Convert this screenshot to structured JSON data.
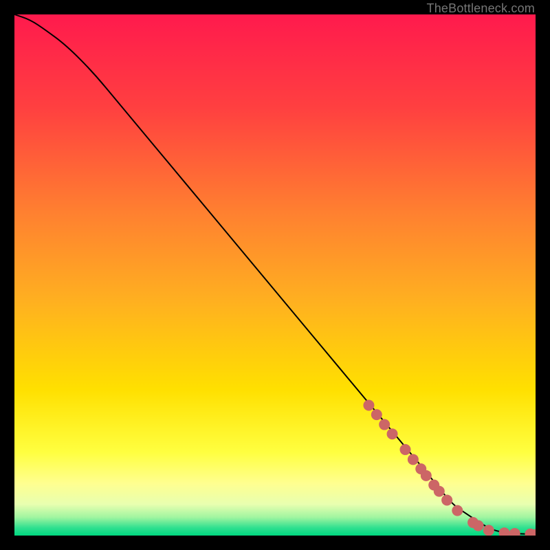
{
  "attribution": "TheBottleneck.com",
  "chart_data": {
    "type": "line",
    "title": "",
    "xlabel": "",
    "ylabel": "",
    "xlim": [
      0,
      100
    ],
    "ylim": [
      0,
      100
    ],
    "grid": false,
    "legend": false,
    "series": [
      {
        "name": "curve",
        "x": [
          0,
          3,
          6,
          10,
          15,
          20,
          25,
          30,
          35,
          40,
          45,
          50,
          55,
          60,
          65,
          70,
          75,
          80,
          84,
          87,
          90,
          92,
          94,
          96,
          98,
          100
        ],
        "y": [
          100,
          99,
          97,
          94,
          89,
          83,
          77,
          71,
          65,
          59,
          53,
          47,
          41,
          35,
          29,
          23,
          17,
          11,
          6,
          4,
          2,
          1,
          0.6,
          0.4,
          0.3,
          0.2
        ]
      }
    ],
    "markers": [
      {
        "x": 68.0,
        "y": 25.0
      },
      {
        "x": 69.5,
        "y": 23.2
      },
      {
        "x": 71.0,
        "y": 21.3
      },
      {
        "x": 72.5,
        "y": 19.5
      },
      {
        "x": 75.0,
        "y": 16.5
      },
      {
        "x": 76.5,
        "y": 14.6
      },
      {
        "x": 78.0,
        "y": 12.8
      },
      {
        "x": 79.0,
        "y": 11.5
      },
      {
        "x": 80.5,
        "y": 9.7
      },
      {
        "x": 81.5,
        "y": 8.5
      },
      {
        "x": 83.0,
        "y": 6.8
      },
      {
        "x": 85.0,
        "y": 4.8
      },
      {
        "x": 88.0,
        "y": 2.5
      },
      {
        "x": 89.0,
        "y": 1.9
      },
      {
        "x": 91.0,
        "y": 1.0
      },
      {
        "x": 94.0,
        "y": 0.5
      },
      {
        "x": 96.0,
        "y": 0.4
      },
      {
        "x": 99.0,
        "y": 0.3
      },
      {
        "x": 100.0,
        "y": 0.2
      }
    ],
    "marker_style": {
      "color": "#cc6666",
      "radius_px": 8
    },
    "background_gradient": {
      "stops": [
        {
          "offset": 0.0,
          "color": "#ff1a4d"
        },
        {
          "offset": 0.18,
          "color": "#ff4040"
        },
        {
          "offset": 0.38,
          "color": "#ff8030"
        },
        {
          "offset": 0.55,
          "color": "#ffb020"
        },
        {
          "offset": 0.72,
          "color": "#ffe000"
        },
        {
          "offset": 0.84,
          "color": "#ffff40"
        },
        {
          "offset": 0.9,
          "color": "#ffff90"
        },
        {
          "offset": 0.94,
          "color": "#e8ffb0"
        },
        {
          "offset": 0.965,
          "color": "#a0f5a0"
        },
        {
          "offset": 0.985,
          "color": "#30e090"
        },
        {
          "offset": 1.0,
          "color": "#00d880"
        }
      ]
    }
  }
}
